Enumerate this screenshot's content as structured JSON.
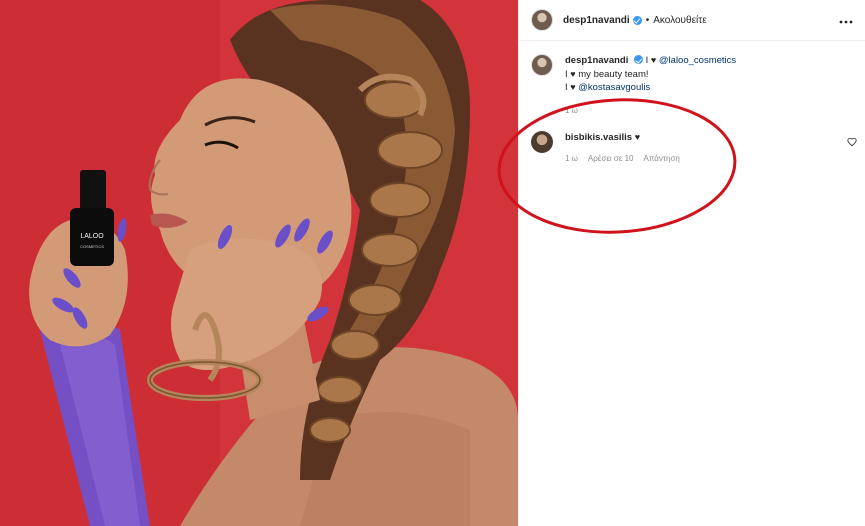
{
  "post": {
    "username": "desp1navandi",
    "separator": "•",
    "follow_label": "Ακολουθείτε",
    "more_icon": "more-options-icon"
  },
  "caption": {
    "username": "desp1navandi",
    "line1_prefix": "I",
    "line1_mention": "@laloo_cosmetics",
    "line2_prefix": "I",
    "line2_text": "my beauty team!",
    "line3_prefix": "I",
    "line3_mention": "@kostasavgoulis",
    "time": "1 ω"
  },
  "comment": {
    "username": "bisbikis.vasilis",
    "time": "1 ω",
    "likes": "Αρέσει σε 10",
    "reply": "Απάντηση"
  },
  "photo": {
    "bottle_brand": "LALOO",
    "bottle_sub": "COSMETICS"
  },
  "colors": {
    "background_red": "#d3333a",
    "nail_purple": "#6a4fc9",
    "annotation_red": "#d0121c",
    "verified_blue": "#3897f0"
  }
}
